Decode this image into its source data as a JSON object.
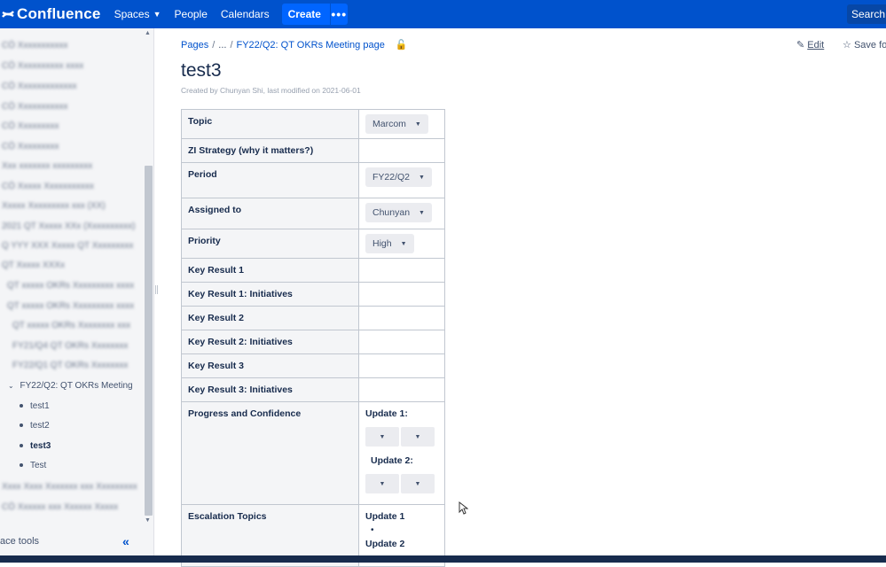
{
  "topbar": {
    "logo_text": "Confluence",
    "nav": [
      {
        "label": "Spaces",
        "has_dropdown": true
      },
      {
        "label": "People"
      },
      {
        "label": "Calendars"
      }
    ],
    "create_label": "Create",
    "more_label": "•••",
    "search_label": "Search"
  },
  "sidebar": {
    "blurred_items": [
      "CÖ Xxxxxxxxxxx",
      "CÖ Xxxxxxxxxx xxxx",
      "CÖ Xxxxxxxxxxxxx",
      "CÖ Xxxxxxxxxxx",
      "CÖ Xxxxxxxxx",
      "CÖ Xxxxxxxxx",
      "Xxx xxxxxxx xxxxxxxxx",
      "CÖ Xxxxx Xxxxxxxxxxx",
      "Xxxxx Xxxxxxxxx xxx (XX)",
      "2021 QT Xxxxx XXx (Xxxxxxxxxx)",
      "Q YYY XXX Xxxxx QT Xxxxxxxxx",
      "QT Xxxxx XXXx",
      "QT xxxxx OKRs Xxxxxxxxx xxxx",
      "QT xxxxx OKRs Xxxxxxxxx xxxx",
      "QT xxxxx OKRs Xxxxxxxx xxx",
      "FY21/Q4 QT OKRs Xxxxxxxx",
      "FY22/Q1 QT OKRs Xxxxxxxx"
    ],
    "expanded_item": "FY22/Q2: QT OKRs Meeting",
    "children": [
      {
        "label": "test1",
        "active": false
      },
      {
        "label": "test2",
        "active": false
      },
      {
        "label": "test3",
        "active": true
      },
      {
        "label": "Test",
        "active": false
      }
    ],
    "blurred_bottom": [
      "Xxxx Xxxx Xxxxxxx xxx Xxxxxxxxx",
      "CÖ Xxxxxx xxx Xxxxxx Xxxxx"
    ],
    "space_tools_label": "ace tools",
    "collapse_label": "«"
  },
  "page": {
    "breadcrumb": [
      "Pages",
      "...",
      "FY22/Q2: QT OKRs Meeting page"
    ],
    "edit_label": "Edit",
    "save_label": "Save fo",
    "title": "test3",
    "byline": "Created by Chunyan Shi, last modified on 2021-06-01"
  },
  "properties": {
    "topic": {
      "key": "Topic",
      "value": "Marcom"
    },
    "zi_strategy": {
      "key": "ZI Strategy (why it matters?)"
    },
    "period": {
      "key": "Period",
      "value": "FY22/Q2"
    },
    "assigned": {
      "key": "Assigned to",
      "value": "Chunyan"
    },
    "priority": {
      "key": "Priority",
      "value": "High"
    },
    "kr1": {
      "key": "Key Result 1"
    },
    "kr1i": {
      "key": "Key Result 1: Initiatives"
    },
    "kr2": {
      "key": "Key Result 2"
    },
    "kr2i": {
      "key": "Key Result 2: Initiatives"
    },
    "kr3": {
      "key": "Key Result 3"
    },
    "kr3i": {
      "key": "Key Result 3: Initiatives"
    },
    "progress": {
      "key": "Progress and Confidence",
      "update1": "Update 1:",
      "update2": "Update 2:"
    },
    "escalation": {
      "key": "Escalation Topics",
      "update1": "Update 1",
      "update2": "Update 2"
    }
  }
}
